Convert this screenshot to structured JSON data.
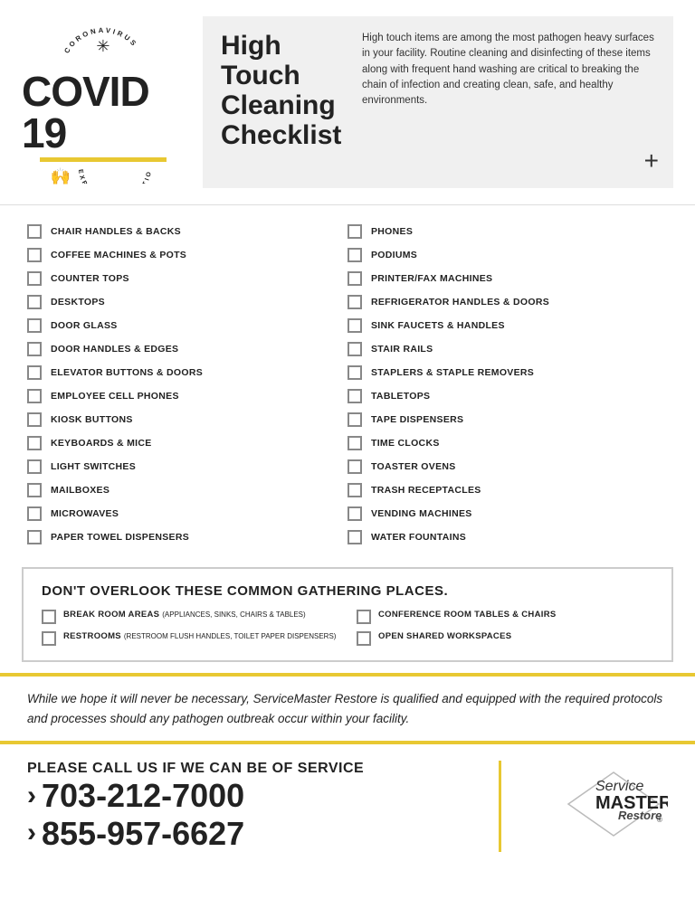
{
  "header": {
    "corona_top": "CORONAVIRUS",
    "covid_title": "COVID 19",
    "exposure_text": "EXPOSURE REDUCTION",
    "checklist_title": "High Touch Cleaning Checklist",
    "checklist_desc": "High touch items are among the most pathogen heavy surfaces in your facility. Routine cleaning and disinfecting of these items along with frequent hand washing are critical to breaking the chain of infection and creating clean, safe, and healthy environments.",
    "plus_symbol": "+"
  },
  "left_column": [
    "CHAIR HANDLES & BACKS",
    "COFFEE MACHINES & POTS",
    "COUNTER TOPS",
    "DESKTOPS",
    "DOOR GLASS",
    "DOOR HANDLES & EDGES",
    "ELEVATOR BUTTONS & DOORS",
    "EMPLOYEE CELL PHONES",
    "KIOSK BUTTONS",
    "KEYBOARDS & MICE",
    "LIGHT SWITCHES",
    "MAILBOXES",
    "MICROWAVES",
    "PAPER TOWEL DISPENSERS"
  ],
  "right_column": [
    "PHONES",
    "PODIUMS",
    "PRINTER/FAX MACHINES",
    "REFRIGERATOR HANDLES & DOORS",
    "SINK FAUCETS & HANDLES",
    "STAIR RAILS",
    "STAPLERS & STAPLE REMOVERS",
    "TABLETOPS",
    "TAPE DISPENSERS",
    "TIME CLOCKS",
    "TOASTER OVENS",
    "TRASH RECEPTACLES",
    "VENDING MACHINES",
    "WATER FOUNTAINS"
  ],
  "gathering": {
    "title": "DON'T OVERLOOK THESE COMMON GATHERING PLACES.",
    "left_items": [
      {
        "label": "BREAK ROOM AREAS",
        "sub": "(APPLIANCES, SINKS, CHAIRS & TABLES)"
      },
      {
        "label": "RESTROOMS",
        "sub": "(RESTROOM FLUSH HANDLES, TOILET PAPER DISPENSERS)"
      }
    ],
    "right_items": [
      {
        "label": "CONFERENCE ROOM TABLES & CHAIRS",
        "sub": ""
      },
      {
        "label": "OPEN SHARED WORKSPACES",
        "sub": ""
      }
    ]
  },
  "footer_banner": {
    "text": "While we hope it will never be necessary, ServiceMaster Restore is qualified and equipped with the required protocols and processes should any pathogen outbreak occur within your facility."
  },
  "cta": {
    "call_label": "PLEASE CALL US IF WE CAN BE OF SERVICE",
    "phone1": "703-212-7000",
    "phone2": "855-957-6627",
    "chevron": "›",
    "brand_service": "Service",
    "brand_master": "MASTER",
    "brand_restore": "Restore",
    "brand_registered": "®"
  }
}
